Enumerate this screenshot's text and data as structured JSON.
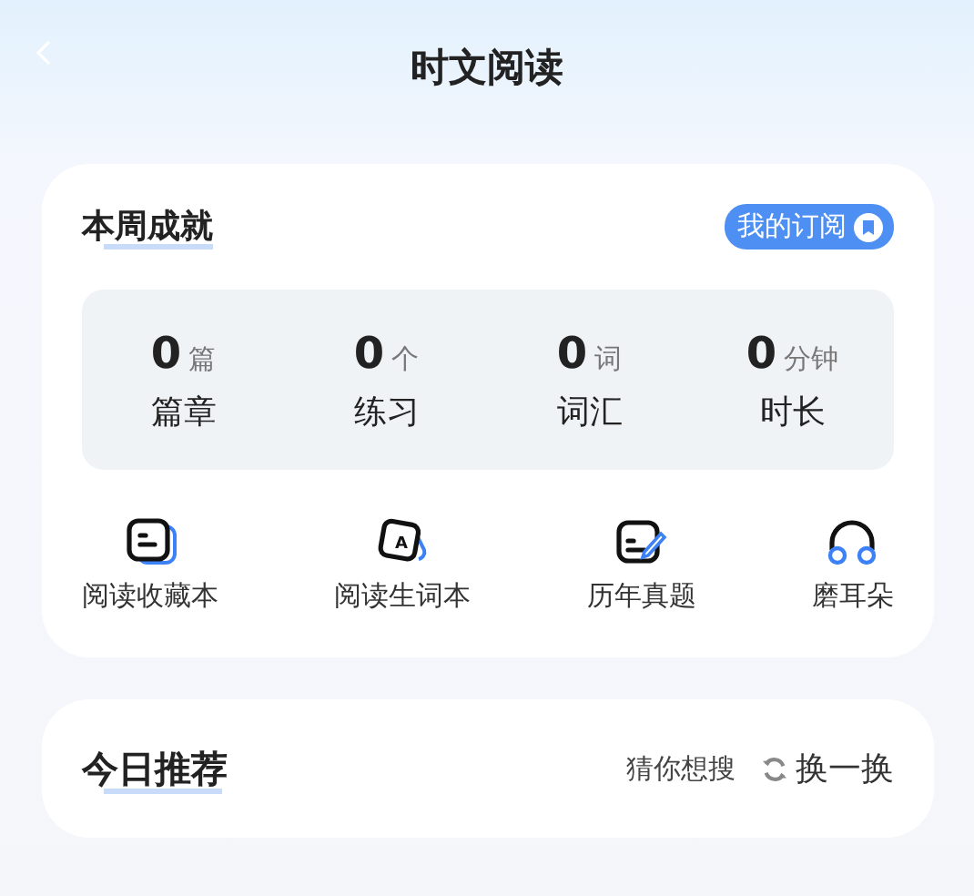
{
  "header": {
    "title": "时文阅读"
  },
  "weekly": {
    "title": "本周成就",
    "subscribe_button": "我的订阅",
    "stats": [
      {
        "value": "0",
        "unit": "篇",
        "label": "篇章"
      },
      {
        "value": "0",
        "unit": "个",
        "label": "练习"
      },
      {
        "value": "0",
        "unit": "词",
        "label": "词汇"
      },
      {
        "value": "0",
        "unit": "分钟",
        "label": "时长"
      }
    ],
    "shortcuts": [
      {
        "kind": "bookmark",
        "label": "阅读收藏本"
      },
      {
        "kind": "vocab",
        "glyph": "A",
        "label": "阅读生词本"
      },
      {
        "kind": "exam",
        "label": "历年真题"
      },
      {
        "kind": "listen",
        "label": "磨耳朵"
      }
    ]
  },
  "today": {
    "title": "今日推荐",
    "guess_link": "猜你想搜",
    "refresh_button": "换一换"
  }
}
